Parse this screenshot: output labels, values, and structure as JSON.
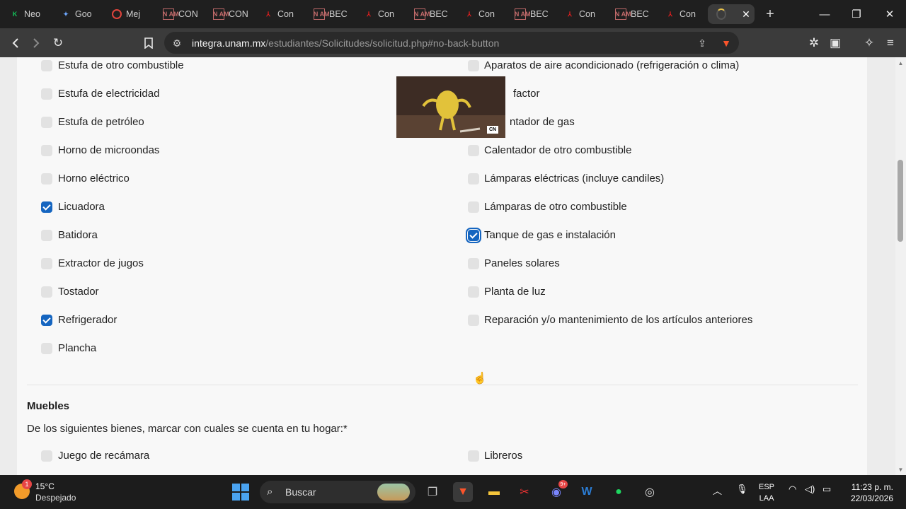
{
  "tabs": [
    {
      "label": "Neo",
      "favicon": "k-icon"
    },
    {
      "label": "Goo",
      "favicon": "gemini-icon"
    },
    {
      "label": "Mej",
      "favicon": "record-icon"
    },
    {
      "label": "CON",
      "favicon": "unam-icon"
    },
    {
      "label": "CON",
      "favicon": "unam-icon"
    },
    {
      "label": "Con",
      "favicon": "pdf-icon"
    },
    {
      "label": "BEC",
      "favicon": "unam-icon"
    },
    {
      "label": "Con",
      "favicon": "pdf-icon"
    },
    {
      "label": "BEC",
      "favicon": "unam-icon"
    },
    {
      "label": "Con",
      "favicon": "pdf-icon"
    },
    {
      "label": "BEC",
      "favicon": "unam-icon"
    },
    {
      "label": "Con",
      "favicon": "pdf-icon"
    },
    {
      "label": "BEC",
      "favicon": "unam-icon"
    },
    {
      "label": "Con",
      "favicon": "pdf-icon"
    }
  ],
  "address": {
    "host": "integra.unam.mx",
    "path": "/estudiantes/Solicitudes/solicitud.php#no-back-button"
  },
  "left_column": [
    {
      "label": "Estufa de otro combustible",
      "checked": false
    },
    {
      "label": "Estufa de electricidad",
      "checked": false
    },
    {
      "label": "Estufa de petróleo",
      "checked": false
    },
    {
      "label": "Horno de microondas",
      "checked": false
    },
    {
      "label": "Horno eléctrico",
      "checked": false
    },
    {
      "label": "Licuadora",
      "checked": true
    },
    {
      "label": "Batidora",
      "checked": false
    },
    {
      "label": "Extractor de jugos",
      "checked": false
    },
    {
      "label": "Tostador",
      "checked": false
    },
    {
      "label": "Refrigerador",
      "checked": true
    },
    {
      "label": "Plancha",
      "checked": false
    }
  ],
  "right_column": [
    {
      "label": "Aparatos de aire acondicionado (refrigeración o clima)",
      "checked": false
    },
    {
      "label": "factor",
      "checked": false
    },
    {
      "label": "ntador de gas",
      "checked": false
    },
    {
      "label": "Calentador de otro combustible",
      "checked": false
    },
    {
      "label": "Lámparas eléctricas (incluye candiles)",
      "checked": false
    },
    {
      "label": "Lámparas de otro combustible",
      "checked": false
    },
    {
      "label": "Tanque de gas e instalación",
      "checked": true
    },
    {
      "label": "Paneles solares",
      "checked": false
    },
    {
      "label": "Planta de luz",
      "checked": false
    },
    {
      "label": "Reparación y/o mantenimiento de los artículos anteriores",
      "checked": false
    }
  ],
  "muebles": {
    "title": "Muebles",
    "description": "De los siguientes bienes, marcar con cuales se cuenta en tu hogar:*",
    "items_left": [
      {
        "label": "Juego de recámara",
        "checked": false
      }
    ],
    "items_right": [
      {
        "label": "Libreros",
        "checked": false
      }
    ]
  },
  "pip_video": {
    "logo": "CN"
  },
  "taskbar": {
    "weather_temp": "15°C",
    "weather_desc": "Despejado",
    "weather_badge": "1",
    "search_label": "Buscar",
    "discord_badge": "9+",
    "lang_top": "ESP",
    "lang_bottom": "LAA",
    "time": "11:23 p. m.",
    "date": "22/03/2026"
  },
  "colors": {
    "accent": "#1565c0",
    "tab_bg": "#1f1f1f",
    "toolbar_bg": "#3b3b3b",
    "page_bg": "#f8f8f8"
  }
}
